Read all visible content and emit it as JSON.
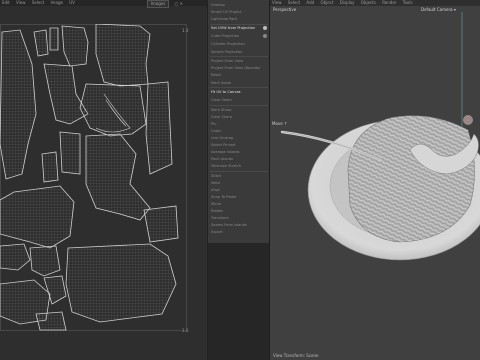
{
  "uv_editor": {
    "menu": [
      "Edit",
      "View",
      "Select",
      "Image",
      "UV"
    ],
    "image_dropdown": "Images",
    "ruler_top": "1.0",
    "ruler_bottom": "1.0"
  },
  "uv_menu": {
    "items": [
      {
        "label": "Unwrap",
        "active": false
      },
      {
        "label": "Smart UV Project",
        "active": false
      },
      {
        "label": "Lightmap Pack",
        "active": false
      },
      {
        "label": "Follow Active Quads",
        "active": false
      },
      {
        "label": "Set UVW from Projection",
        "active": true,
        "dot": true
      },
      {
        "label": "Cube Projection",
        "active": false,
        "dot": true
      },
      {
        "label": "Cylinder Projection",
        "active": false
      },
      {
        "label": "Sphere Projection",
        "active": false
      },
      {
        "label": "Project From View",
        "active": false
      },
      {
        "label": "Project From View (Bounds)",
        "active": false
      },
      {
        "label": "Reset",
        "active": false
      },
      {
        "label": "Mark Seam",
        "active": false
      },
      {
        "label": "Fit UV to Canvas",
        "active": true
      },
      {
        "label": "Clear Seam",
        "active": false
      },
      {
        "label": "Mark Sharp",
        "active": false
      },
      {
        "label": "Clear Sharp",
        "active": false
      },
      {
        "label": "Pin",
        "active": false
      },
      {
        "label": "Unpin",
        "active": false
      },
      {
        "label": "Live Unwrap",
        "active": false
      },
      {
        "label": "Select Pinned",
        "active": false
      },
      {
        "label": "Average Islands",
        "active": false
      },
      {
        "label": "Pack Islands",
        "active": false
      },
      {
        "label": "Minimize Stretch",
        "active": false
      },
      {
        "label": "Stitch",
        "active": false
      },
      {
        "label": "Weld",
        "active": false
      },
      {
        "label": "Align",
        "active": false
      },
      {
        "label": "Snap To Pixels",
        "active": false
      },
      {
        "label": "Mirror",
        "active": false
      },
      {
        "label": "Rotate",
        "active": false
      },
      {
        "label": "Transform",
        "active": false
      },
      {
        "label": "Seams From Islands",
        "active": false
      },
      {
        "label": "Export",
        "active": false
      }
    ]
  },
  "viewport": {
    "menu": [
      "View",
      "Select",
      "Add",
      "Object",
      "Display",
      "Objects",
      "Render",
      "Tools"
    ],
    "view_name": "Perspective",
    "camera_label": "Default Camera ▾",
    "gizmo_label": "Move ↑",
    "status_text": "View Transform: Scene"
  },
  "colors": {
    "accent": "#5a8a8a",
    "plate": "#d4d4d4",
    "background": "#404040"
  }
}
